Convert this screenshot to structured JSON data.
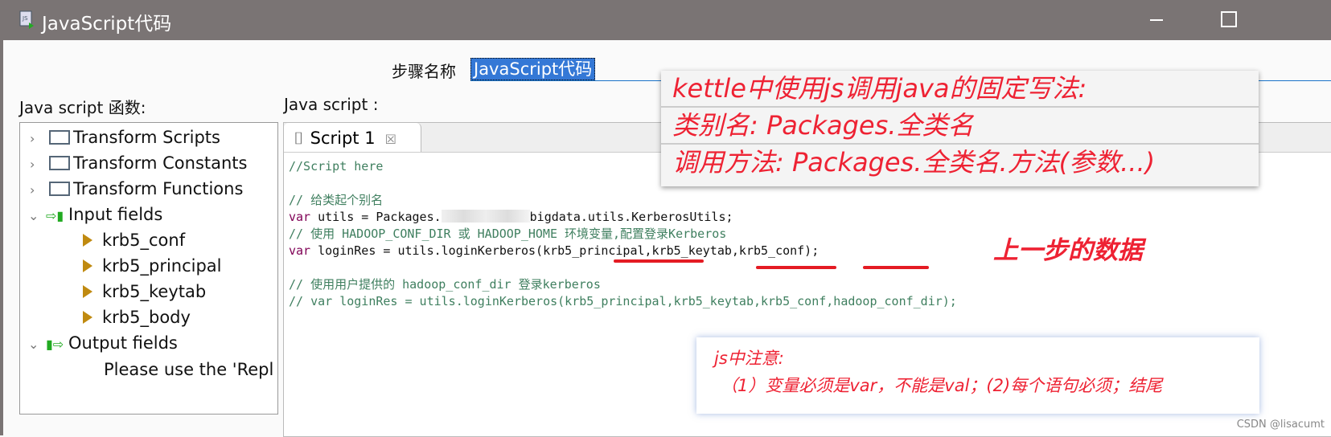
{
  "window": {
    "title": "JavaScript代码",
    "icon": "js-script-icon"
  },
  "step": {
    "label": "步骤名称",
    "value": "JavaScript代码"
  },
  "functions": {
    "label": "Java script 函数:",
    "tree": [
      {
        "label": "Transform Scripts",
        "type": "folder"
      },
      {
        "label": "Transform Constants",
        "type": "folder"
      },
      {
        "label": "Transform Functions",
        "type": "folder"
      },
      {
        "label": "Input fields",
        "type": "input",
        "children": [
          "krb5_conf",
          "krb5_principal",
          "krb5_keytab",
          "krb5_body"
        ]
      },
      {
        "label": "Output fields",
        "type": "output",
        "children": [
          "Please use the 'Repl"
        ]
      }
    ]
  },
  "script": {
    "label": "Java script :",
    "tab": "Script 1",
    "lines": [
      "//Script here",
      "// 给类起个别名",
      "var",
      "utils = Packages.",
      "bigdata.utils.KerberosUtils;",
      "// 使用 HADOOP_CONF_DIR 或 HADOOP_HOME 环境变量,配置登录Kerberos",
      "var",
      "loginRes = utils.loginKerberos(krb5_principal,krb5_keytab,krb5_conf);",
      "// 使用用户提供的 hadoop_conf_dir 登录kerberos",
      "// var loginRes = utils.loginKerberos(krb5_principal,krb5_keytab,krb5_conf,hadoop_conf_dir);"
    ]
  },
  "annotations": {
    "box1": [
      "kettle中使用js调用java的固定写法:",
      "类别名:   Packages.全类名",
      "调用方法:    Packages.全类名.方法(参数...)"
    ],
    "prev_data": "上一步的数据",
    "box2": [
      "js中注意:",
      "（1）变量必须是var，不能是val；(2)每个语句必须；结尾"
    ],
    "watermark": "CSDN @lisacumt"
  },
  "colors": {
    "titlebar": "#7a7474",
    "annotation": "#ee2233",
    "selection": "#3478d6"
  }
}
